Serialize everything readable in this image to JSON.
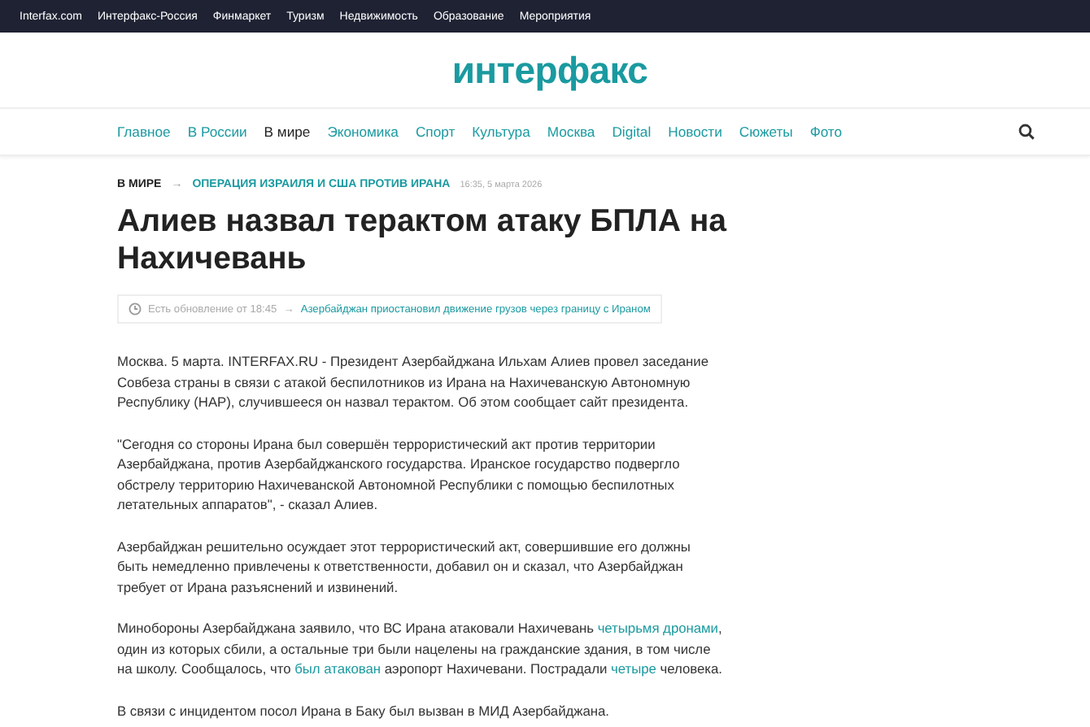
{
  "top_bar": {
    "links": [
      "Interfax.com",
      "Интерфакс-Россия",
      "Финмаркет",
      "Туризм",
      "Недвижимость",
      "Образование",
      "Мероприятия"
    ]
  },
  "logo": "интерфакс",
  "nav": [
    {
      "label": "Главное",
      "selected": false
    },
    {
      "label": "В России",
      "selected": false
    },
    {
      "label": "В мире",
      "selected": true
    },
    {
      "label": "Экономика",
      "selected": false
    },
    {
      "label": "Спорт",
      "selected": false
    },
    {
      "label": "Культура",
      "selected": false
    },
    {
      "label": "Москва",
      "selected": false
    },
    {
      "label": "Digital",
      "selected": false
    },
    {
      "label": "Новости",
      "selected": false
    },
    {
      "label": "Сюжеты",
      "selected": false
    },
    {
      "label": "Фото",
      "selected": false
    }
  ],
  "breadcrumb": {
    "section": "В МИРЕ",
    "arrow": "→",
    "story": "ОПЕРАЦИЯ ИЗРАИЛЯ И США ПРОТИВ ИРАНА",
    "time": "16:35, 5 марта 2026"
  },
  "headline": "Алиев назвал терактом атаку БПЛА на Нахичевань",
  "update": {
    "label": "Есть обновление от 18:45",
    "arrow": "→",
    "link": "Азербайджан приостановил движение грузов через границу с Ираном"
  },
  "paragraphs": [
    [
      {
        "text": "Москва. 5 марта. INTERFAX.RU - Президент Азербайджана Ильхам Алиев провел заседание Совбеза страны в связи с атакой беспилотников из Ирана на Нахичеванскую Автономную Республику (НАР), случившееся он назвал терактом. Об этом сообщает сайт президента.",
        "link": false
      }
    ],
    [
      {
        "text": "\"Сегодня со стороны Ирана был совершён террористический акт против территории Азербайджана, против Азербайджанского государства. Иранское государство подвергло обстрелу территорию Нахичеванской Автономной Республики с помощью беспилотных летательных аппаратов\", - сказал Алиев.",
        "link": false
      }
    ],
    [
      {
        "text": "Азербайджан решительно осуждает этот террористический акт, совершившие его должны быть немедленно привлечены к ответственности, добавил он и сказал, что Азербайджан требует от Ирана разъяснений и извинений.",
        "link": false
      }
    ],
    [
      {
        "text": "Минобороны Азербайджана заявило, что ВС Ирана атаковали Нахичевань ",
        "link": false
      },
      {
        "text": "четырьмя дронами",
        "link": true
      },
      {
        "text": ", один из которых сбили, а остальные три были нацелены на гражданские здания, в том числе на школу. Сообщалось, что ",
        "link": false
      },
      {
        "text": "был атакован",
        "link": true
      },
      {
        "text": " аэропорт Нахичевани. Пострадали ",
        "link": false
      },
      {
        "text": "четыре",
        "link": true
      },
      {
        "text": " человека.",
        "link": false
      }
    ],
    [
      {
        "text": "В связи с инцидентом посол Ирана в Баку был вызван в МИД Азербайджана.",
        "link": false
      }
    ]
  ]
}
